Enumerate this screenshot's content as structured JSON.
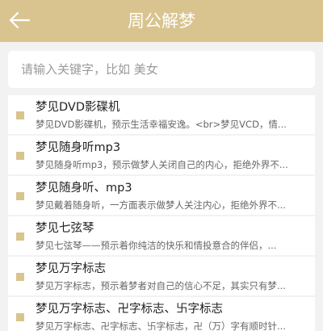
{
  "header": {
    "title": "周公解梦",
    "back_icon": "back-arrow-icon",
    "color": "#d9c48f"
  },
  "search": {
    "placeholder": "请输入关键字，比如 美女",
    "value": ""
  },
  "items": [
    {
      "title": "梦见DVD影碟机",
      "desc": "梦见DVD影碟机，预示生活幸福安逸。<br>梦见VCD，情..."
    },
    {
      "title": "梦见随身听mp3",
      "desc": "梦见随身听mp3，预示做梦人关闭自己的内心，拒绝外界不..."
    },
    {
      "title": "梦见随身听、mp3",
      "desc": "梦见戴着随身听，一方面表示做梦人关注内心，拒绝外界不..."
    },
    {
      "title": "梦见七弦琴",
      "desc": "梦见七弦琴——预示着你纯洁的快乐和情投意合的伴侣，..."
    },
    {
      "title": "梦见万字标志",
      "desc": "梦见万字标志，预示着梦者对自己的信心不足，其实只有梦..."
    },
    {
      "title": "梦见万字标志、卍字标志、卐字标志",
      "desc": "梦见万字标志、卍字标志、卐字标志，卍（万）字有顺时针..."
    }
  ]
}
